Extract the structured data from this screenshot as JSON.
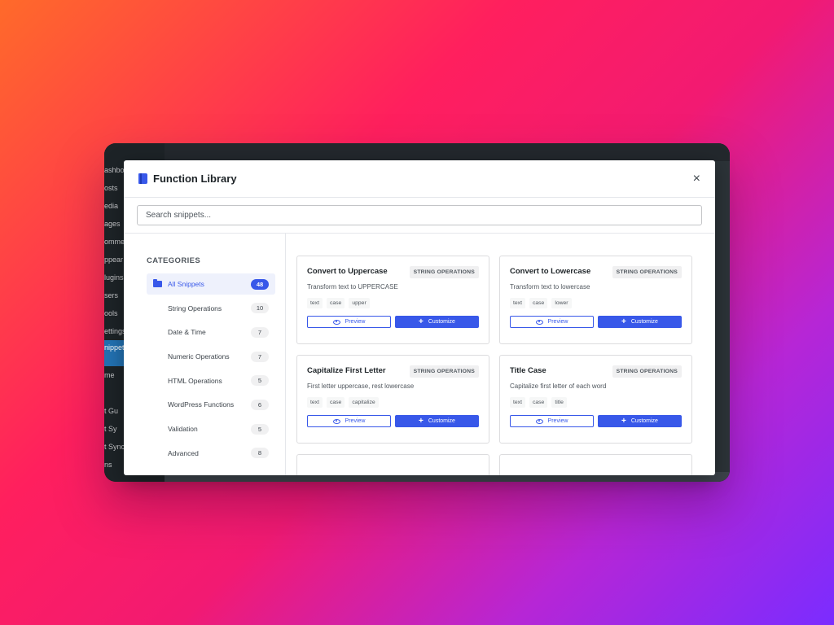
{
  "wp_sidebar": {
    "items": [
      "ashbo",
      "osts",
      "edia",
      "ages",
      "omme",
      "ppear",
      "lugins",
      "sers",
      "ools",
      "ettings",
      "nippet cks",
      "me",
      "",
      "t Gu",
      "t Sy",
      "t Sync",
      "ns"
    ]
  },
  "modal": {
    "title": "Function Library",
    "close_label": "×"
  },
  "search": {
    "placeholder": "Search snippets...",
    "value": ""
  },
  "categories": {
    "heading": "CATEGORIES",
    "items": [
      {
        "label": "All Snippets",
        "count": "48",
        "active": true
      },
      {
        "label": "String Operations",
        "count": "10",
        "active": false
      },
      {
        "label": "Date & Time",
        "count": "7",
        "active": false
      },
      {
        "label": "Numeric Operations",
        "count": "7",
        "active": false
      },
      {
        "label": "HTML Operations",
        "count": "5",
        "active": false
      },
      {
        "label": "WordPress Functions",
        "count": "6",
        "active": false
      },
      {
        "label": "Validation",
        "count": "5",
        "active": false
      },
      {
        "label": "Advanced",
        "count": "8",
        "active": false
      }
    ]
  },
  "snippets": [
    {
      "title": "Convert to Uppercase",
      "category": "STRING OPERATIONS",
      "description": "Transform text to UPPERCASE",
      "tags": [
        "text",
        "case",
        "upper"
      ],
      "preview_label": "Preview",
      "customize_label": "Customize"
    },
    {
      "title": "Convert to Lowercase",
      "category": "STRING OPERATIONS",
      "description": "Transform text to lowercase",
      "tags": [
        "text",
        "case",
        "lower"
      ],
      "preview_label": "Preview",
      "customize_label": "Customize"
    },
    {
      "title": "Capitalize First Letter",
      "category": "STRING OPERATIONS",
      "description": "First letter uppercase, rest lowercase",
      "tags": [
        "text",
        "case",
        "capitalize"
      ],
      "preview_label": "Preview",
      "customize_label": "Customize"
    },
    {
      "title": "Title Case",
      "category": "STRING OPERATIONS",
      "description": "Capitalize first letter of each word",
      "tags": [
        "text",
        "case",
        "title"
      ],
      "preview_label": "Preview",
      "customize_label": "Customize"
    }
  ],
  "colors": {
    "accent": "#3858e9",
    "background_start": "#ff6a2a",
    "background_end": "#7b2cff"
  }
}
